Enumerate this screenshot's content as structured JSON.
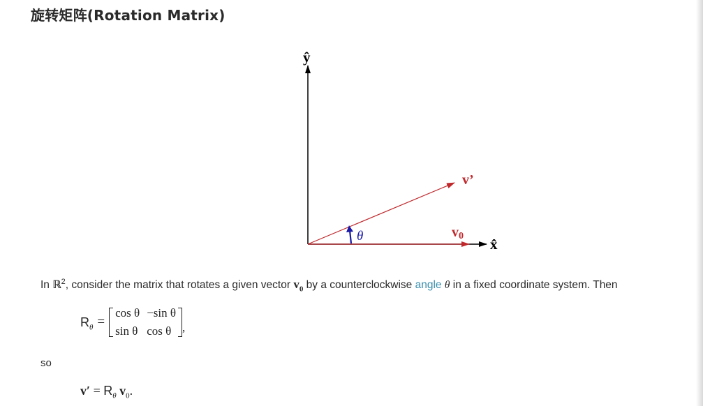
{
  "heading": "旋转矩阵(Rotation Matrix)",
  "figure": {
    "y_axis_label": "ŷ",
    "x_axis_label": "x̂",
    "v_prime_label": "v’",
    "v0_label": "v",
    "v0_subscript": "0",
    "angle_label": "θ",
    "colors": {
      "axis": "#000000",
      "vector": "#c0282c",
      "angle_arrow": "#1a1aa8"
    }
  },
  "paragraph": {
    "in": "In",
    "R": "ℝ",
    "sup": "2",
    "text1": ", consider the matrix that rotates a given vector",
    "v0": "v",
    "v0_sub": "0",
    "text2": "by a counterclockwise",
    "link": "angle",
    "theta": "θ",
    "text3": "in a fixed coordinate system. Then"
  },
  "equation1": {
    "R": "R",
    "R_sub": "θ",
    "equals": "=",
    "m11": "cos θ",
    "m12": "−sin θ",
    "m21": "sin θ",
    "m22": "cos θ",
    "comma": ","
  },
  "so": "so",
  "equation2": {
    "lhs": "v′",
    "equals": "=",
    "R": "R",
    "R_sub": "θ",
    "v": "v",
    "v_sub": "0",
    "period": "."
  }
}
